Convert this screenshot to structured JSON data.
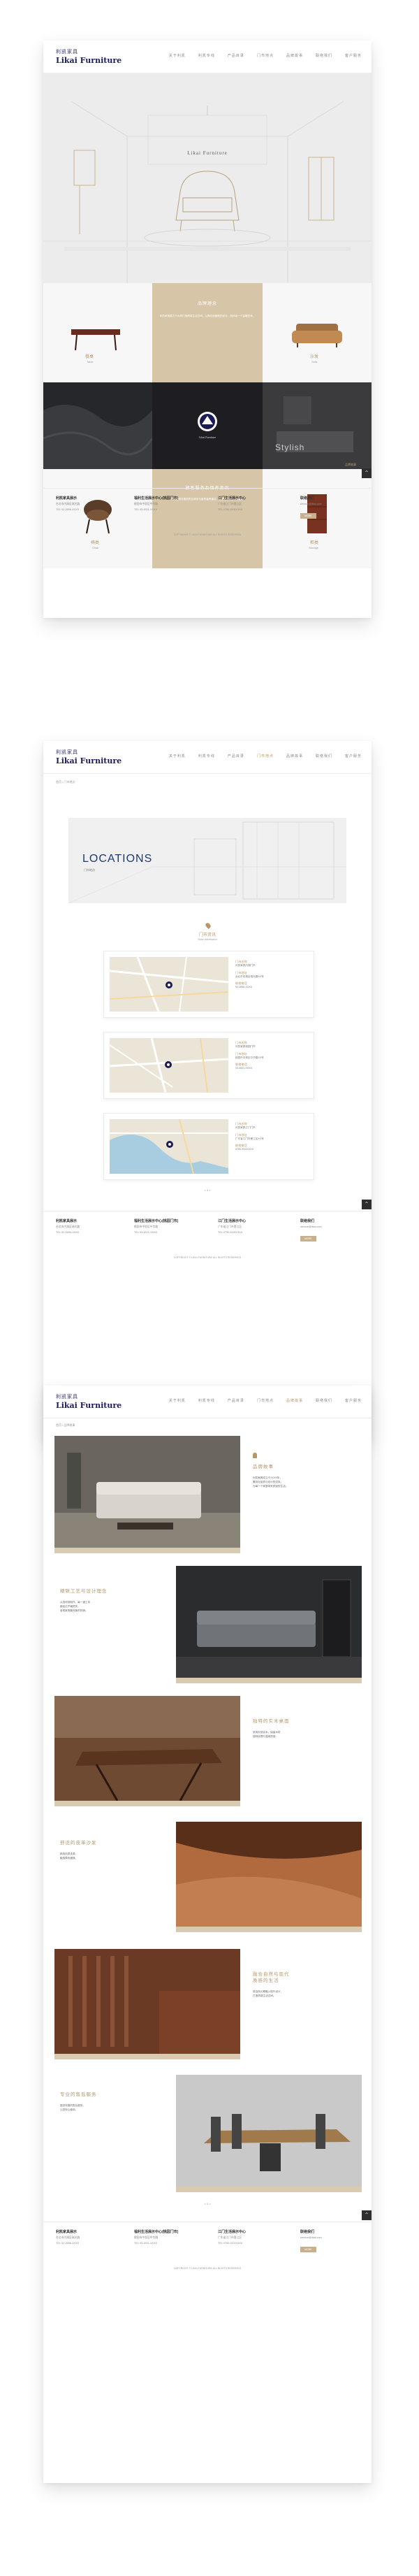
{
  "brand": {
    "cn": "利凯家具",
    "en": "Likai Furniture"
  },
  "nav": [
    "关于利凯",
    "利凯专线",
    "产品目录",
    "门市地点",
    "品牌故事",
    "联络我们",
    "客户服务"
  ],
  "page1": {
    "hero_title": "Likai Furniture",
    "cells": {
      "table": {
        "label": "餐桌",
        "sub": "Table"
      },
      "sofa": {
        "label": "沙发",
        "sub": "Sofa"
      },
      "chair": {
        "label": "椅类",
        "sub": "Chair"
      },
      "cabinet": {
        "label": "柜类",
        "sub": "Storage"
      },
      "concept_title": "品牌理念",
      "concept_text": "利凯家具致力于为您打造质感生活空间，以简约而精致的设计，陪伴每一个温暖的家。",
      "service_title": "顾客服务及保养资讯",
      "service_text": "我们提供完善的售后服务与家具保养建议，让您的家具历久弥新。",
      "stylish_caption": "Stylish",
      "badge_text": "Likai Furniture"
    },
    "side_tag": "品牌故事"
  },
  "footer": {
    "cols": [
      {
        "title": "利凯家具展示",
        "lines": [
          "台北市内湖区瑞光路",
          "TEL 02-2656-XXXX"
        ]
      },
      {
        "title": "福利生活展示中心(桃园门市)",
        "lines": [
          "桃园市中坜区中华路",
          "TEL 03-4521-XXXX"
        ]
      },
      {
        "title": "江门生活展示中心",
        "lines": [
          "广东省江门市蓬江区",
          "TEL 0750-XXXXXXX"
        ]
      },
      {
        "title": "联络我们",
        "lines": [
          "service@likai.com"
        ],
        "button": "MORE"
      }
    ],
    "copyright": "COPYRIGHT © LIKAI FURNITURE ALL RIGHTS RESERVED"
  },
  "page2": {
    "breadcrumb": "首页 / 门市地点",
    "title": "LOCATIONS",
    "subtitle": "门市地点",
    "store_heading": "门市资讯",
    "store_sub": "Store Information",
    "stores": [
      {
        "name_label": "门市名称",
        "name": "利凯家具内湖门市",
        "addr_label": "门市地址",
        "addr": "台北市内湖区瑞光路XX号",
        "tel_label": "联络电话",
        "tel": "02-2656-XXXX"
      },
      {
        "name_label": "门市名称",
        "name": "利凯家具桃园门市",
        "addr_label": "门市地址",
        "addr": "桃园市中坜区中华路XX号",
        "tel_label": "联络电话",
        "tel": "03-4521-XXXX"
      },
      {
        "name_label": "门市名称",
        "name": "利凯家具江门门市",
        "addr_label": "门市地址",
        "addr": "广东省江门市蓬江区XX号",
        "tel_label": "联络电话",
        "tel": "0750-XXXXXXX"
      }
    ],
    "pager": "< 1 >"
  },
  "page3": {
    "breadcrumb": "首页 / 品牌故事",
    "blocks": [
      {
        "title": "品牌故事",
        "body": "利凯家具成立于XXXX年，\n秉持对品质与设计的坚持，\n为每一个家庭带来舒适的生活。"
      },
      {
        "title": "精致工艺与设计理念",
        "body": "从选材到制作，每一道工序\n都经过严格把关，\n呈现家具最完美的样貌。"
      },
      {
        "title": "独特的实木桌面",
        "body": "采用天然实木，保留木材\n独特纹理与温润质感。"
      },
      {
        "title": "舒适的皮革沙发",
        "body": "精选优质皮革，\n触感柔软细致。"
      },
      {
        "title": "融合自然与现代\n质感的生活",
        "body": "将自然元素融入现代设计，\n打造质感生活空间。"
      },
      {
        "title": "专业的售后服务",
        "body": "提供完善的售后服务，\n让您安心使用。"
      }
    ],
    "pager": "< 1 >"
  },
  "colors": {
    "accent": "#b7976a",
    "navy": "#1b1b55",
    "tan": "#d6c6a7",
    "dark": "#2f3034"
  }
}
